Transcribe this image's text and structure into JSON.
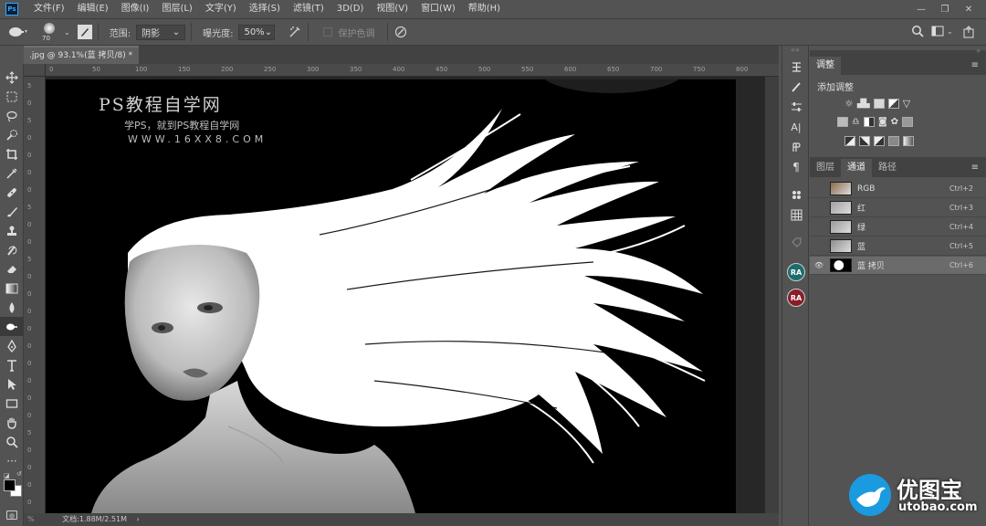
{
  "app": {
    "name": "Ps"
  },
  "menu": [
    "文件(F)",
    "编辑(E)",
    "图像(I)",
    "图层(L)",
    "文字(Y)",
    "选择(S)",
    "滤镜(T)",
    "3D(D)",
    "视图(V)",
    "窗口(W)",
    "帮助(H)"
  ],
  "options": {
    "brush_size": "70",
    "range_label": "范围:",
    "range_value": "阴影",
    "exposure_label": "曝光度:",
    "exposure_value": "50%",
    "protect_tone_label": "保护色调"
  },
  "document": {
    "tab_label": ".jpg @ 93.1%(蓝 拷贝/8) *",
    "close": "×",
    "status": "文档:1.88M/2.51M"
  },
  "ruler": {
    "h_ticks": [
      "0",
      "50",
      "100",
      "150",
      "200",
      "250",
      "300",
      "350",
      "400",
      "450",
      "500",
      "550",
      "600",
      "650",
      "700",
      "750",
      "800"
    ],
    "v_ticks": [
      "5",
      "0",
      "5",
      "0",
      "0",
      "0",
      "0",
      "5",
      "0",
      "0",
      "5",
      "0",
      "0",
      "0",
      "0",
      "0",
      "0",
      "0",
      "0",
      "0",
      "5",
      "0",
      "0",
      "0",
      "0"
    ]
  },
  "watermark": {
    "title": "PS教程自学网",
    "sub": "学PS，就到PS教程自学网",
    "url": "WWW.16XX8.COM"
  },
  "right_icons": {
    "ra1": "RA",
    "ra2": "RA"
  },
  "adjustments": {
    "tab": "调整",
    "add_label": "添加调整"
  },
  "channels": {
    "tabs": [
      "图层",
      "通道",
      "路径"
    ],
    "selected_tab": 1,
    "rows": [
      {
        "name": "RGB",
        "key": "Ctrl+2",
        "visible": false,
        "selected": false
      },
      {
        "name": "红",
        "key": "Ctrl+3",
        "visible": false,
        "selected": false
      },
      {
        "name": "绿",
        "key": "Ctrl+4",
        "visible": false,
        "selected": false
      },
      {
        "name": "蓝",
        "key": "Ctrl+5",
        "visible": false,
        "selected": false
      },
      {
        "name": "蓝 拷贝",
        "key": "Ctrl+6",
        "visible": true,
        "selected": true
      }
    ]
  },
  "site_logo": {
    "name": "优图宝",
    "url": "utobao.com"
  },
  "colors": {
    "ui_bg": "#535353",
    "dark": "#424242",
    "canvas": "#000000",
    "accent_blue": "#31a8ff",
    "ra_teal": "#1e6d6d",
    "ra_red": "#8a1d2a"
  }
}
